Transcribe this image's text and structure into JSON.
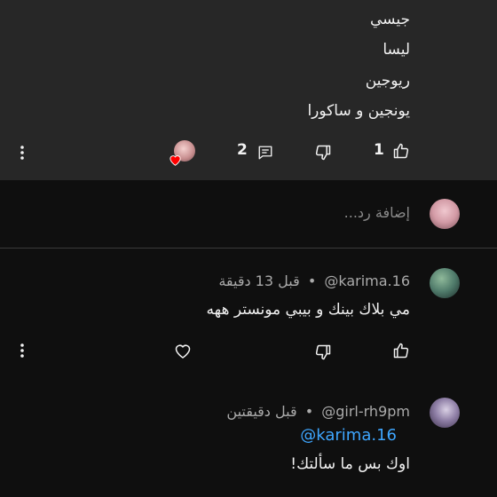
{
  "top_comment": {
    "lines": [
      "جيسي",
      "ليسا",
      "ريوجين",
      "يونجين و ساكورا"
    ],
    "likes": "1",
    "replies": "2"
  },
  "reply_box": {
    "placeholder": "إضافة رد..."
  },
  "comments": [
    {
      "handle": "@karima.16",
      "time": "قبل 13 دقيقة",
      "text": "مي بلاك بينك و بيبي مونستر ههه"
    },
    {
      "handle": "@girl-rh9pm",
      "time": "قبل دقيقتين",
      "mention": "@karima.16",
      "text": "اوك بس ما سألتك!"
    }
  ],
  "separator": "•",
  "icons": {
    "like": "thumbs-up-icon",
    "dislike": "thumbs-down-icon",
    "reply": "comment-icon",
    "more": "more-vert-icon",
    "heart": "heart-icon"
  },
  "colors": {
    "background": "#0f0f0f",
    "highlight_bg": "#272727",
    "text": "#f1f1f1",
    "secondary": "#aaaaaa",
    "mention": "#3ea6ff",
    "heart_badge": "#ff0000"
  }
}
